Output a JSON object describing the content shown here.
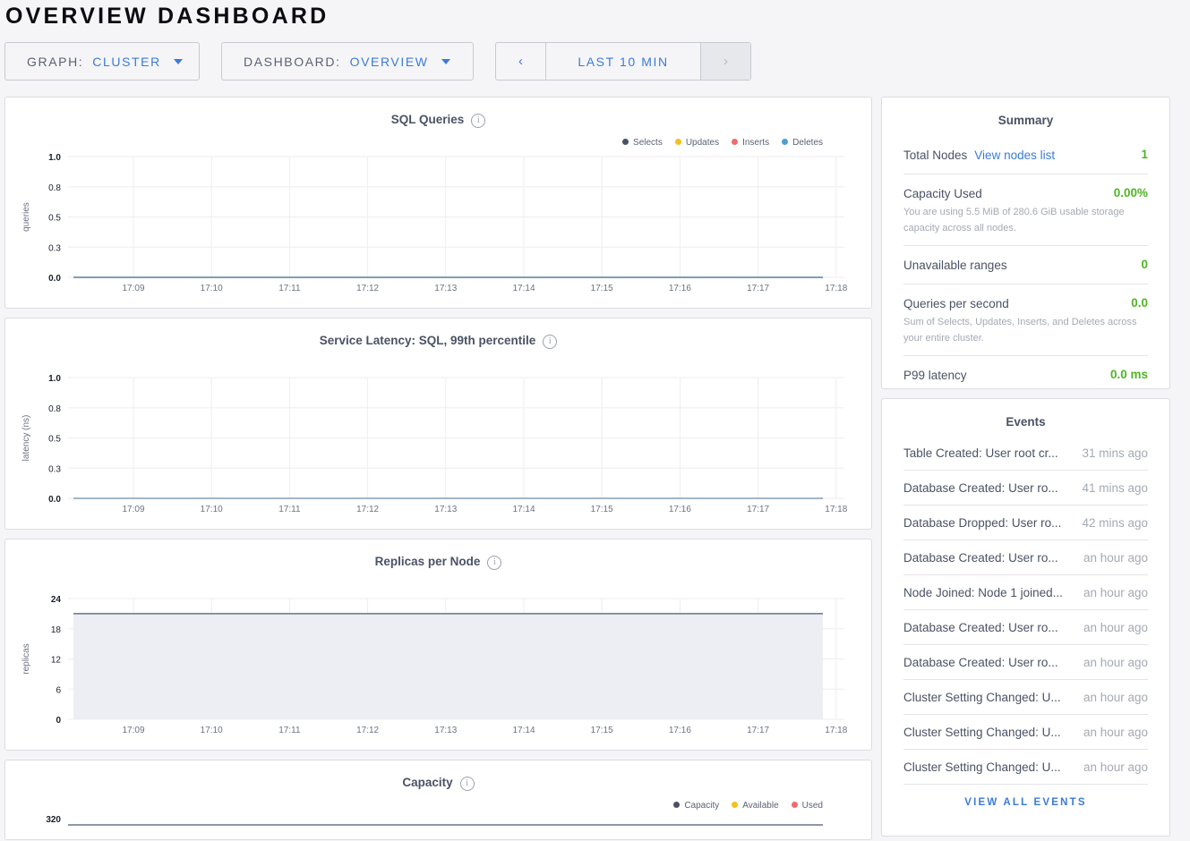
{
  "page": {
    "title": "OVERVIEW DASHBOARD"
  },
  "controls": {
    "graph": {
      "label": "GRAPH:",
      "value": "CLUSTER"
    },
    "dashboard": {
      "label": "DASHBOARD:",
      "value": "OVERVIEW"
    },
    "time": {
      "label": "LAST 10 MIN",
      "prev": "‹",
      "next": "›"
    }
  },
  "info_glyph": "i",
  "charts": [
    {
      "title": "SQL Queries",
      "ylabel": "queries",
      "legend": [
        {
          "name": "Selects",
          "color": "#4a5264"
        },
        {
          "name": "Updates",
          "color": "#f5c01d"
        },
        {
          "name": "Inserts",
          "color": "#f16b6b"
        },
        {
          "name": "Deletes",
          "color": "#4b9fd5"
        }
      ]
    },
    {
      "title": "Service Latency: SQL, 99th percentile",
      "ylabel": "latency (ns)",
      "legend": []
    },
    {
      "title": "Replicas per Node",
      "ylabel": "replicas",
      "legend": []
    },
    {
      "title": "Capacity",
      "ylabel": "",
      "legend": [
        {
          "name": "Capacity",
          "color": "#4a5264"
        },
        {
          "name": "Available",
          "color": "#f5c01d"
        },
        {
          "name": "Used",
          "color": "#f16b6b"
        }
      ]
    }
  ],
  "chart_data": [
    {
      "type": "line",
      "title": "SQL Queries",
      "ylabel": "queries",
      "x_ticks": [
        "17:09",
        "17:10",
        "17:11",
        "17:12",
        "17:13",
        "17:14",
        "17:15",
        "17:16",
        "17:17",
        "17:18"
      ],
      "y_ticks": [
        "1.0",
        "0.8",
        "0.5",
        "0.3",
        "0.0"
      ],
      "ylim": [
        0,
        1
      ],
      "grid": true,
      "legend_position": "top-right",
      "series": [
        {
          "name": "Selects",
          "values": [
            0,
            0,
            0,
            0,
            0,
            0,
            0,
            0,
            0,
            0
          ]
        },
        {
          "name": "Updates",
          "values": [
            0,
            0,
            0,
            0,
            0,
            0,
            0,
            0,
            0,
            0
          ]
        },
        {
          "name": "Inserts",
          "values": [
            0,
            0,
            0,
            0,
            0,
            0,
            0,
            0,
            0,
            0
          ]
        },
        {
          "name": "Deletes",
          "values": [
            0,
            0,
            0,
            0,
            0,
            0,
            0,
            0,
            0,
            0
          ]
        }
      ]
    },
    {
      "type": "line",
      "title": "Service Latency: SQL, 99th percentile",
      "ylabel": "latency (ns)",
      "x_ticks": [
        "17:09",
        "17:10",
        "17:11",
        "17:12",
        "17:13",
        "17:14",
        "17:15",
        "17:16",
        "17:17",
        "17:18"
      ],
      "y_ticks": [
        "1.0",
        "0.8",
        "0.5",
        "0.3",
        "0.0"
      ],
      "ylim": [
        0,
        1
      ],
      "grid": true,
      "series": [
        {
          "values": [
            0,
            0,
            0,
            0,
            0,
            0,
            0,
            0,
            0,
            0
          ]
        }
      ]
    },
    {
      "type": "area",
      "title": "Replicas per Node",
      "ylabel": "replicas",
      "x_ticks": [
        "17:09",
        "17:10",
        "17:11",
        "17:12",
        "17:13",
        "17:14",
        "17:15",
        "17:16",
        "17:17",
        "17:18"
      ],
      "y_ticks": [
        "24",
        "18",
        "12",
        "6",
        "0"
      ],
      "ylim": [
        0,
        24
      ],
      "grid": true,
      "series": [
        {
          "values": [
            21,
            21,
            21,
            21,
            21,
            21,
            21,
            21,
            21,
            21
          ]
        }
      ]
    },
    {
      "type": "line",
      "title": "Capacity",
      "y_ticks": [
        "320"
      ],
      "legend_position": "top-right",
      "series": [
        {
          "name": "Capacity"
        },
        {
          "name": "Available"
        },
        {
          "name": "Used"
        }
      ]
    }
  ],
  "summary": {
    "title": "Summary",
    "rows": [
      {
        "key": "Total Nodes",
        "link": "View nodes list",
        "value": "1",
        "desc": ""
      },
      {
        "key": "Capacity Used",
        "link": "",
        "value": "0.00%",
        "desc": "You are using 5.5 MiB of 280.6 GiB usable storage capacity across all nodes."
      },
      {
        "key": "Unavailable ranges",
        "link": "",
        "value": "0",
        "desc": ""
      },
      {
        "key": "Queries per second",
        "link": "",
        "value": "0.0",
        "desc": "Sum of Selects, Updates, Inserts, and Deletes across your entire cluster."
      },
      {
        "key": "P99 latency",
        "link": "",
        "value": "0.0 ms",
        "desc": ""
      }
    ]
  },
  "events": {
    "title": "Events",
    "items": [
      {
        "text": "Table Created: User root cr...",
        "ago": "31 mins ago"
      },
      {
        "text": "Database Created: User ro...",
        "ago": "41 mins ago"
      },
      {
        "text": "Database Dropped: User ro...",
        "ago": "42 mins ago"
      },
      {
        "text": "Database Created: User ro...",
        "ago": "an hour ago"
      },
      {
        "text": "Node Joined: Node 1 joined...",
        "ago": "an hour ago"
      },
      {
        "text": "Database Created: User ro...",
        "ago": "an hour ago"
      },
      {
        "text": "Database Created: User ro...",
        "ago": "an hour ago"
      },
      {
        "text": "Cluster Setting Changed: U...",
        "ago": "an hour ago"
      },
      {
        "text": "Cluster Setting Changed: U...",
        "ago": "an hour ago"
      },
      {
        "text": "Cluster Setting Changed: U...",
        "ago": "an hour ago"
      }
    ],
    "view_all": "VIEW ALL EVENTS"
  }
}
